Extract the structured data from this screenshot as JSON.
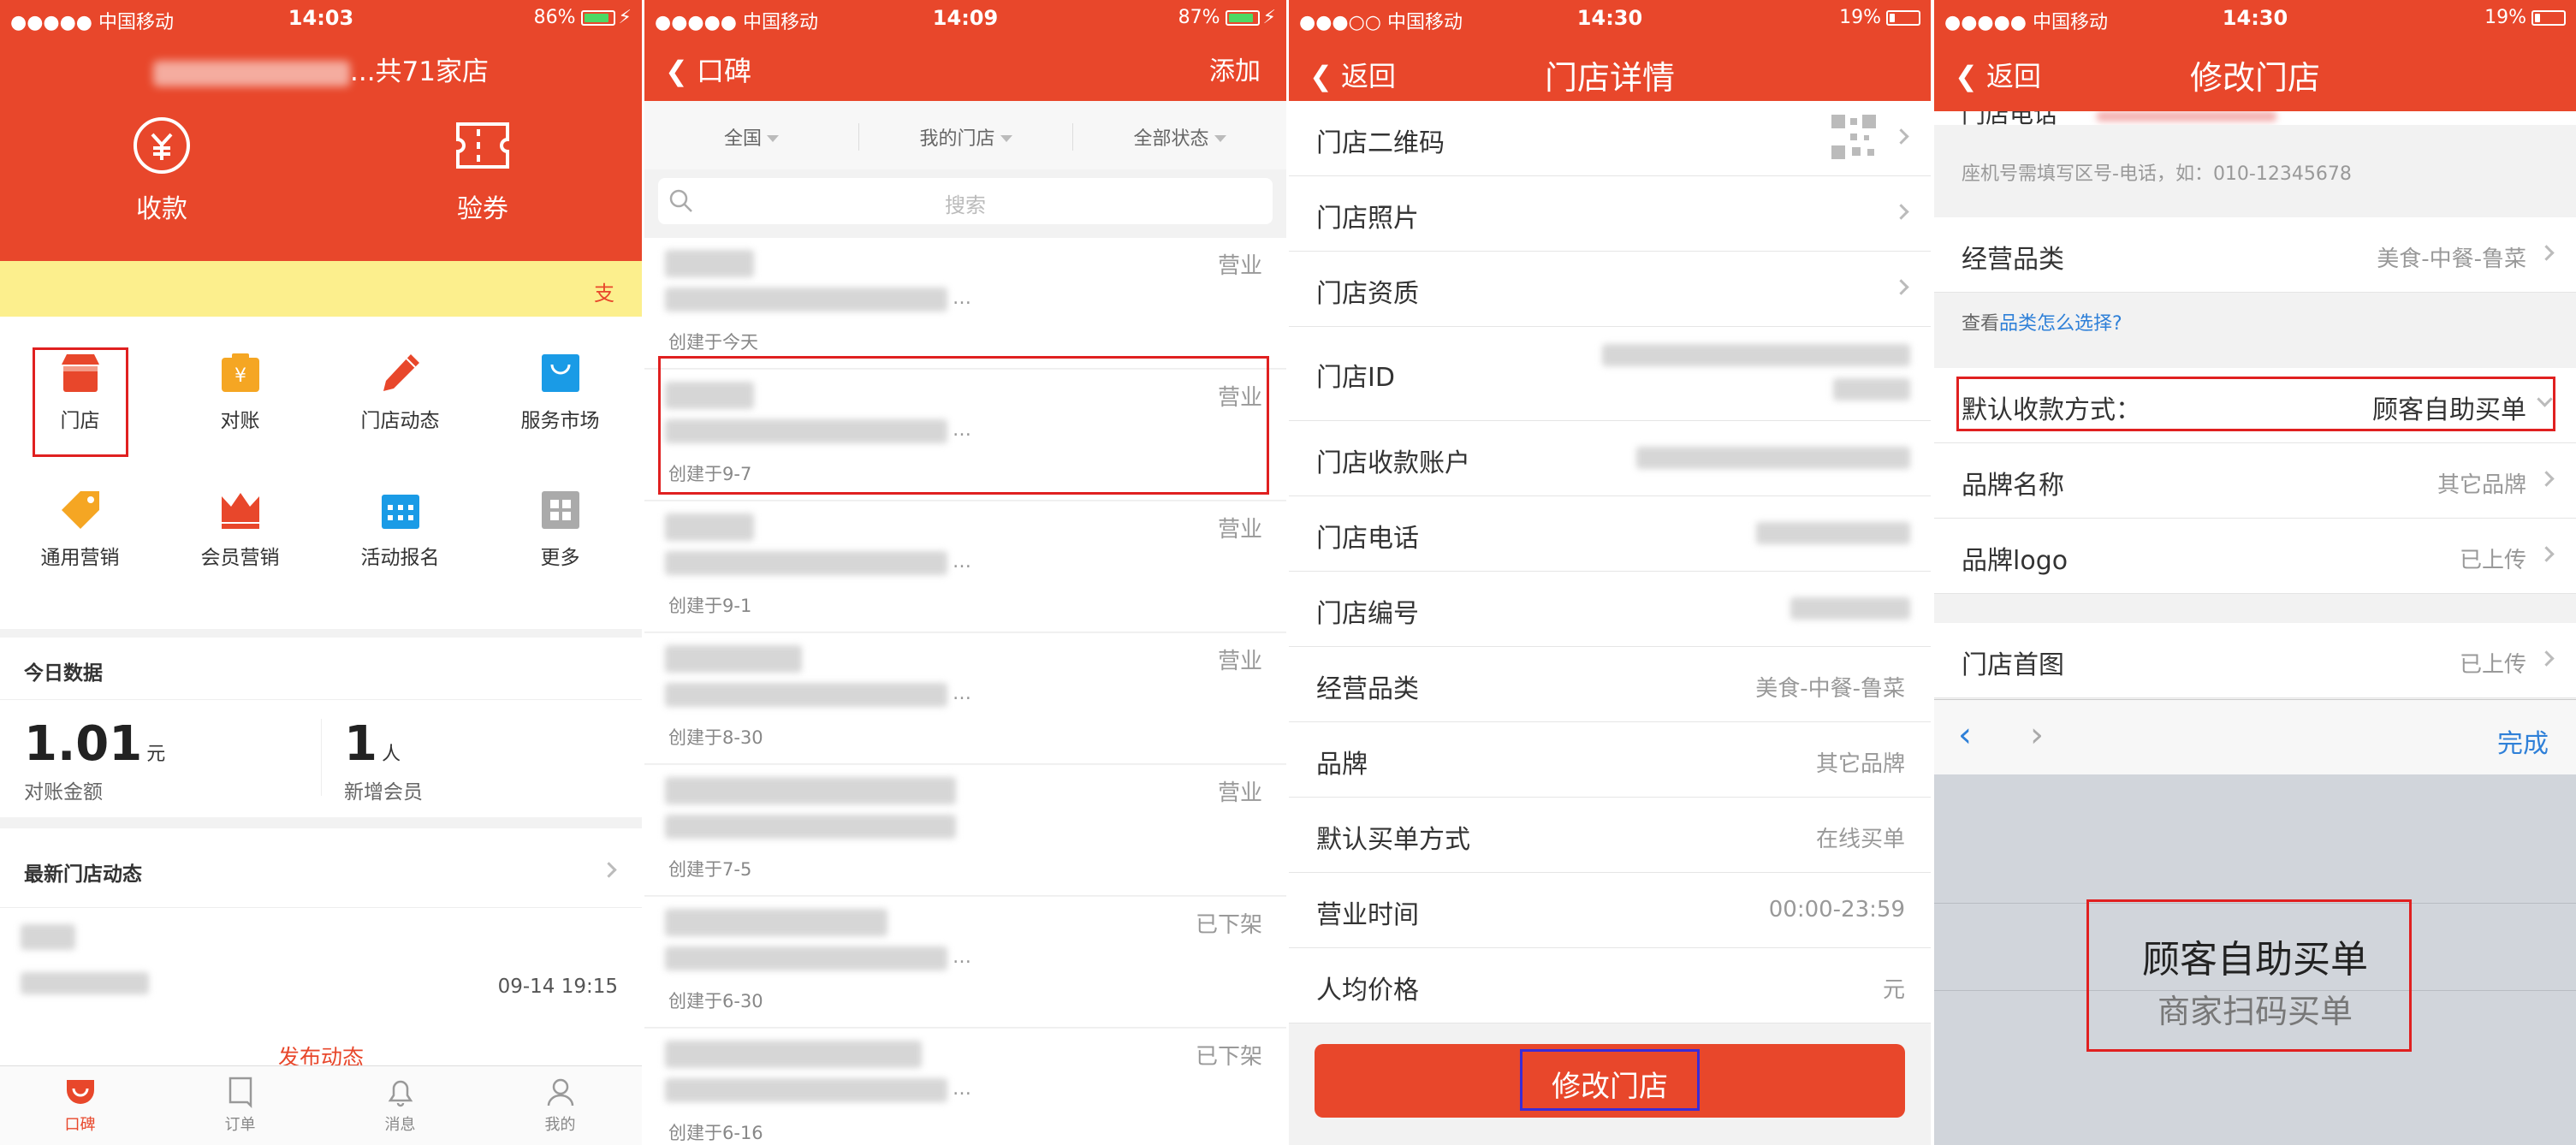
{
  "colors": {
    "brand": "#e8472b",
    "notice_bg": "#fcef8d",
    "link": "#2f80d8"
  },
  "screen1": {
    "status": {
      "carrier": "●●●●● 中国移动",
      "time": "14:03",
      "battery": "86%"
    },
    "store_summary": "...共71家店",
    "top_actions": [
      {
        "label": "收款",
        "icon": "collect-yuan-icon"
      },
      {
        "label": "验券",
        "icon": "coupon-ticket-icon"
      }
    ],
    "notice": "支",
    "grid": [
      {
        "label": "门店",
        "icon": "store-icon"
      },
      {
        "label": "对账",
        "icon": "reconcile-bag-icon"
      },
      {
        "label": "门店动态",
        "icon": "pencil-icon"
      },
      {
        "label": "服务市场",
        "icon": "shopping-bag-icon"
      },
      {
        "label": "通用营销",
        "icon": "tag-icon"
      },
      {
        "label": "会员营销",
        "icon": "crown-icon"
      },
      {
        "label": "活动报名",
        "icon": "calendar-icon"
      },
      {
        "label": "更多",
        "icon": "more-grid-icon"
      }
    ],
    "today": {
      "title": "今日数据",
      "amount": "1.01",
      "amount_unit": "元",
      "amount_label": "对账金额",
      "members": "1",
      "members_unit": "人",
      "members_label": "新增会员"
    },
    "news": {
      "title": "最新门店动态",
      "time": "09-14 19:15",
      "post": "发布动态"
    },
    "tabs": [
      {
        "label": "口碑",
        "icon": "koubei-icon"
      },
      {
        "label": "订单",
        "icon": "order-icon"
      },
      {
        "label": "消息",
        "icon": "bell-icon"
      },
      {
        "label": "我的",
        "icon": "profile-icon"
      }
    ]
  },
  "screen2": {
    "status": {
      "carrier": "●●●●● 中国移动",
      "time": "14:09",
      "battery": "87%"
    },
    "nav": {
      "back": "口碑",
      "action": "添加"
    },
    "filters": [
      "全国",
      "我的门店",
      "全部状态"
    ],
    "search_placeholder": "搜索",
    "stores": [
      {
        "status": "营业",
        "created": "创建于今天"
      },
      {
        "status": "营业",
        "created": "创建于9-7"
      },
      {
        "status": "营业",
        "created": "创建于9-1"
      },
      {
        "status": "营业",
        "created": "创建于8-30"
      },
      {
        "status": "营业",
        "created": "创建于7-5"
      },
      {
        "status": "已下架",
        "created": "创建于6-30"
      },
      {
        "status": "已下架",
        "created": "创建于6-16"
      }
    ]
  },
  "screen3": {
    "status": {
      "carrier": "●●●○○ 中国移动",
      "time": "14:30",
      "battery": "19%"
    },
    "nav": {
      "back": "返回",
      "title": "门店详情"
    },
    "rows": [
      {
        "key": "门店二维码",
        "value": ""
      },
      {
        "key": "门店照片",
        "value": ""
      },
      {
        "key": "门店资质",
        "value": ""
      },
      {
        "key": "门店ID",
        "value": ""
      },
      {
        "key": "门店收款账户",
        "value": ""
      },
      {
        "key": "门店电话",
        "value": ""
      },
      {
        "key": "门店编号",
        "value": ""
      },
      {
        "key": "经营品类",
        "value": "美食-中餐-鲁菜"
      },
      {
        "key": "品牌",
        "value": "其它品牌"
      },
      {
        "key": "默认买单方式",
        "value": "在线买单"
      },
      {
        "key": "营业时间",
        "value": "00:00-23:59"
      },
      {
        "key": "人均价格",
        "value": "元"
      }
    ],
    "edit_button": "修改门店"
  },
  "screen4": {
    "status": {
      "carrier": "●●●●● 中国移动",
      "time": "14:30",
      "battery": "19%"
    },
    "nav": {
      "back": "返回",
      "title": "修改门店"
    },
    "partial_label": "门店电话",
    "phone_hint": "座机号需填写区号-电话，如：010-12345678",
    "category": {
      "key": "经营品类",
      "value": "美食-中餐-鲁菜"
    },
    "help": {
      "prefix": "查看",
      "link": "品类怎么选择?"
    },
    "payment": {
      "key": "默认收款方式：",
      "value": "顾客自助买单"
    },
    "brand": {
      "key": "品牌名称",
      "value": "其它品牌"
    },
    "logo": {
      "key": "品牌logo",
      "value": "已上传"
    },
    "cover": {
      "key": "门店首图",
      "value": "已上传"
    },
    "done": "完成",
    "picker": {
      "selected": "顾客自助买单",
      "other": "商家扫码买单"
    }
  }
}
